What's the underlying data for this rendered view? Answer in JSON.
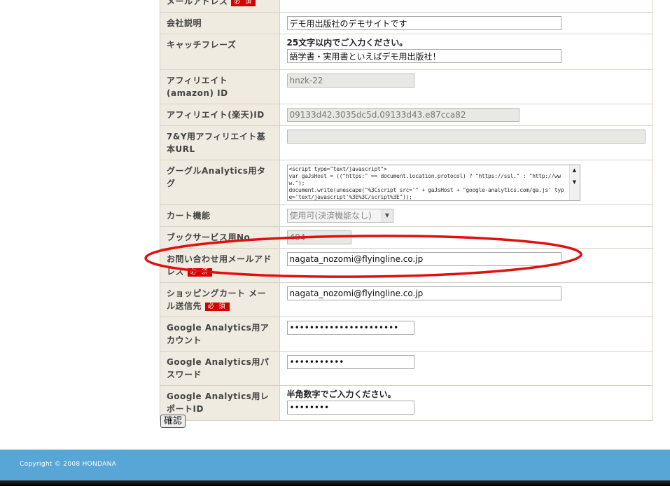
{
  "form": {
    "top_label": "メールアドレス",
    "required_text": "必 須",
    "rows": {
      "company_desc": {
        "label": "会社説明",
        "value": "デモ用出版社のデモサイトです"
      },
      "catchphrase": {
        "label": "キャッチフレーズ",
        "hint": "25文字以内でご入力ください。",
        "value": "語学書・実用書といえばデモ用出版社！"
      },
      "aff_amazon": {
        "label": "アフィリエイト(amazon) ID",
        "value": "hnzk-22"
      },
      "aff_rakuten": {
        "label": "アフィリエイト(楽天)ID",
        "value": "09133d42.3035dc5d.09133d43.e87cca82"
      },
      "aff_7y": {
        "label": "7&Y用アフィリエイト基本URL",
        "value": ""
      },
      "analytics_tag": {
        "label": "グーグルAnalytics用タグ",
        "value": "<script type=\"text/javascript\">\nvar gaJsHost = ((\"https:\" == document.location.protocol) ? \"https://ssl.\" : \"http://www.\");\ndocument.write(unescape(\"%3Cscript src='\" + gaJsHost + \"google-analytics.com/ga.js' type='text/javascript'%3E%3C/script%3E\"));"
      },
      "cart": {
        "label": "カート機能",
        "selected": "使用可(決済機能なし)"
      },
      "book_service": {
        "label": "ブックサービス用No",
        "value": "404"
      },
      "contact_email": {
        "label": "お問い合わせ用メールアドレス",
        "value": "nagata_nozomi@flyingline.co.jp"
      },
      "cart_email": {
        "label": "ショッピングカート メール送信先",
        "value": "nagata_nozomi@flyingline.co.jp"
      },
      "ga_account": {
        "label": "Google Analytics用アカウント",
        "value": "••••••••••••••••••••••"
      },
      "ga_password": {
        "label": "Google Analytics用パスワード",
        "value": "•••••••••••"
      },
      "ga_report": {
        "label": "Google Analytics用レポートID",
        "hint": "半角数字でご入力ください。",
        "value": "••••••••"
      }
    }
  },
  "confirm_button": "確認",
  "footer": {
    "copyright": "Copyright © 2008 HONDANA"
  },
  "colors": {
    "label_bg": "#f0ebe1",
    "required": "#d40000",
    "footer": "#58a6d6",
    "annotation": "#e01010"
  }
}
